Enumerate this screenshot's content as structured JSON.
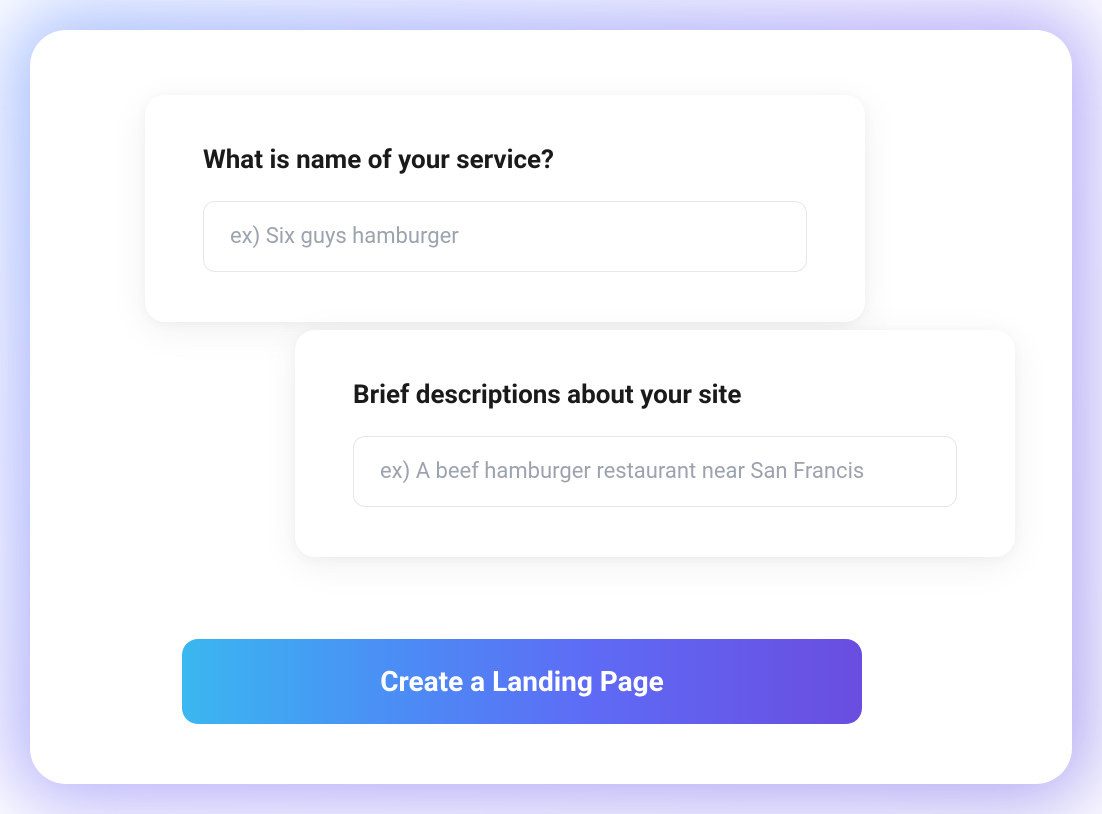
{
  "form": {
    "service_name": {
      "label": "What is name of your service?",
      "placeholder": "ex) Six guys hamburger",
      "value": ""
    },
    "description": {
      "label": "Brief descriptions about your site",
      "placeholder": "ex) A beef hamburger restaurant near San Francis",
      "value": ""
    },
    "submit_label": "Create a Landing Page"
  }
}
